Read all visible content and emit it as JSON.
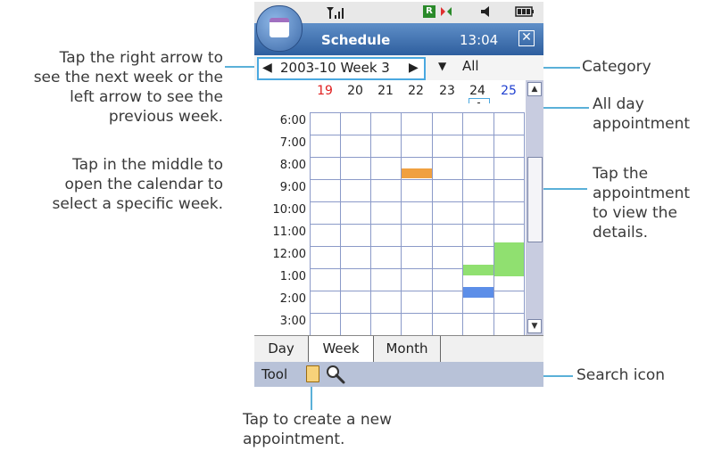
{
  "callouts": {
    "week_nav_lines": [
      "Tap the right arrow to",
      "see the next week or the",
      "left arrow to see the",
      "previous week."
    ],
    "calendar_lines": [
      "Tap in the middle to",
      "open the calendar to",
      "select a specific week."
    ],
    "category": "Category",
    "all_day_lines": [
      "All day",
      "appointment"
    ],
    "appointment_lines": [
      "Tap the",
      "appointment",
      "to view the",
      "details."
    ],
    "search": "Search icon",
    "new_appt_lines": [
      "Tap to create a new",
      "appointment."
    ]
  },
  "phone": {
    "title": "Schedule",
    "clock": "13:04",
    "week_label": "2003-10 Week 3",
    "category_value": "All",
    "days": [
      {
        "label": "19",
        "color": "#e02020"
      },
      {
        "label": "20",
        "color": "#222222"
      },
      {
        "label": "21",
        "color": "#222222"
      },
      {
        "label": "22",
        "color": "#222222"
      },
      {
        "label": "23",
        "color": "#222222"
      },
      {
        "label": "24",
        "color": "#222222"
      },
      {
        "label": "25",
        "color": "#2040d0"
      }
    ],
    "hours": [
      "6:00",
      "7:00",
      "8:00",
      "9:00",
      "10:00",
      "11:00",
      "12:00",
      "1:00",
      "2:00",
      "3:00"
    ],
    "tabs": [
      "Day",
      "Week",
      "Month"
    ],
    "active_tab": "Week",
    "toolbar_label": "Tool",
    "appointment_colors": {
      "orange": "#f0a040",
      "green": "#90e070",
      "blue": "#5c8ee8"
    }
  }
}
